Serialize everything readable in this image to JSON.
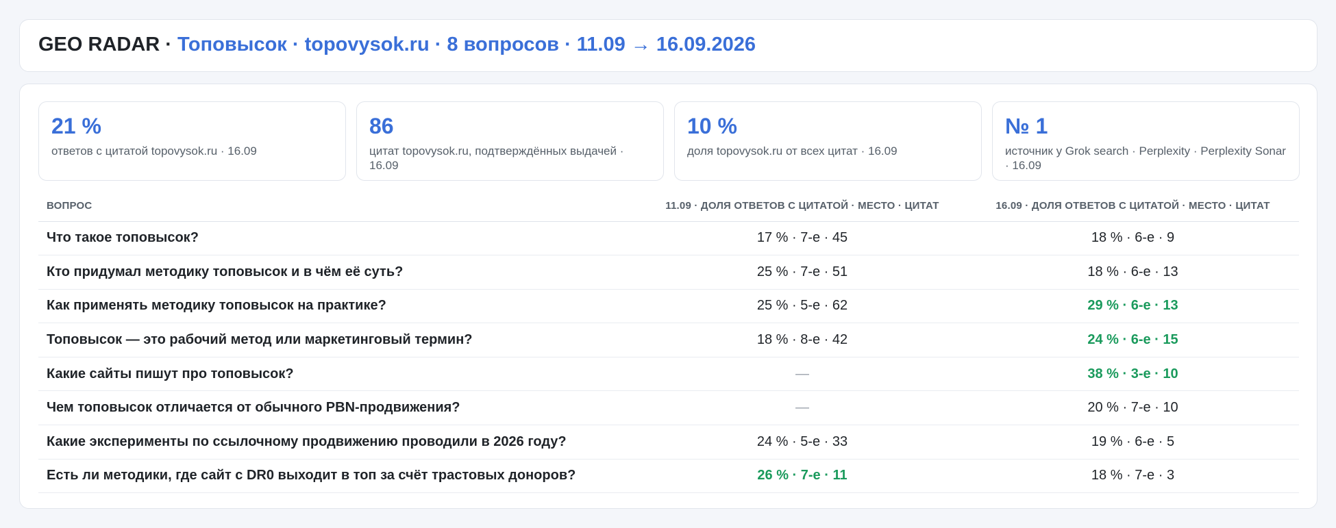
{
  "header": {
    "brand": "GEO RADAR ·",
    "meta": "Топовысок · topovysok.ru · 8 вопросов · 11.09 → 16.09.2026"
  },
  "kpis": [
    {
      "value": "21 %",
      "desc": "ответов с цитатой topovysok.ru · 16.09"
    },
    {
      "value": "86",
      "desc": "цитат topovysok.ru, подтверждённых выдачей · 16.09"
    },
    {
      "value": "10 %",
      "desc": "доля topovysok.ru от всех цитат · 16.09"
    },
    {
      "value": "№ 1",
      "desc": "источник у Grok search · Perplexity · Perplexity Sonar · 16.09"
    }
  ],
  "table": {
    "headers": {
      "question": "Вопрос",
      "old": "11.09 · доля ответов с цитатой · место · цитат",
      "new": "16.09 · доля ответов с цитатой · место · цитат"
    },
    "rows": [
      {
        "question": "Что такое топовысок?",
        "old": "17 % · 7-е · 45",
        "new": "18 % · 6-е · 9",
        "old_hl": false,
        "new_hl": false
      },
      {
        "question": "Кто придумал методику топовысок и в чём её суть?",
        "old": "25 % · 7-е · 51",
        "new": "18 % · 6-е · 13",
        "old_hl": false,
        "new_hl": false
      },
      {
        "question": "Как применять методику топовысок на практике?",
        "old": "25 % · 5-е · 62",
        "new": "29 % · 6-е · 13",
        "old_hl": false,
        "new_hl": true
      },
      {
        "question": "Топовысок — это рабочий метод или маркетинговый термин?",
        "old": "18 % · 8-е · 42",
        "new": "24 % · 6-е · 15",
        "old_hl": false,
        "new_hl": true
      },
      {
        "question": "Какие сайты пишут про топовысок?",
        "old": "—",
        "new": "38 % · 3-е · 10",
        "old_hl": false,
        "new_hl": true
      },
      {
        "question": "Чем топовысок отличается от обычного PBN-продвижения?",
        "old": "—",
        "new": "20 % · 7-е · 10",
        "old_hl": false,
        "new_hl": false
      },
      {
        "question": "Какие эксперименты по ссылочному продвижению проводили в 2026 году?",
        "old": "24 % · 5-е · 33",
        "new": "19 % · 6-е · 5",
        "old_hl": false,
        "new_hl": false
      },
      {
        "question": "Есть ли методики, где сайт с DR0 выходит в топ за счёт трастовых доноров?",
        "old": "26 % · 7-е · 11",
        "new": "18 % · 7-е · 3",
        "old_hl": true,
        "new_hl": false
      }
    ]
  },
  "colors": {
    "accent": "#3a6fd8",
    "positive": "#1a9a5c",
    "muted": "#57606a"
  }
}
